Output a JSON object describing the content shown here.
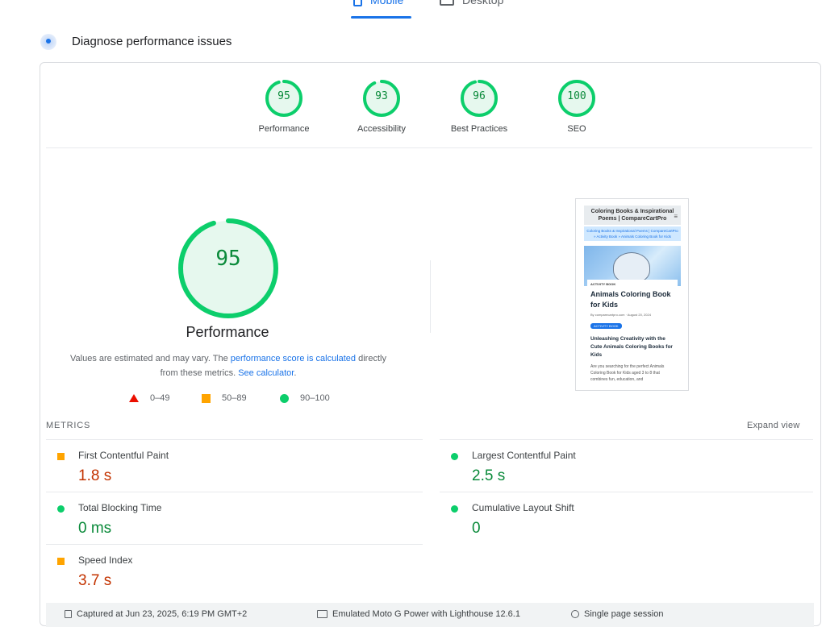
{
  "tabs": [
    {
      "label": "Mobile",
      "active": true,
      "icon": "phone-icon"
    },
    {
      "label": "Desktop",
      "active": false,
      "icon": "monitor-icon"
    }
  ],
  "header": {
    "title": "Diagnose performance issues"
  },
  "scores": [
    {
      "label": "Performance",
      "value": "95",
      "fraction": 0.95
    },
    {
      "label": "Accessibility",
      "value": "93",
      "fraction": 0.93
    },
    {
      "label": "Best Practices",
      "value": "96",
      "fraction": 0.96
    },
    {
      "label": "SEO",
      "value": "100",
      "fraction": 1.0
    }
  ],
  "main_score": {
    "value": "95",
    "fraction": 0.95,
    "title": "Performance",
    "note_prefix": "Values are estimated and may vary. The ",
    "note_link1": "performance score is calculated",
    "note_middle": " directly from these metrics. ",
    "note_link2": "See calculator",
    "note_suffix": "."
  },
  "legend": [
    {
      "range": "0–49",
      "shape": "triangle",
      "color": "#eb0f00"
    },
    {
      "range": "50–89",
      "shape": "square",
      "color": "#ffa400"
    },
    {
      "range": "90–100",
      "shape": "circle",
      "color": "#0cce6b"
    }
  ],
  "thumbnail": {
    "site_title": "Coloring Books & Inspirational Poems | CompareCartPro",
    "breadcrumb": "Coloring Books & Inspirational Poems | CompareCartPro » Activity Book » Animals Coloring Book for Kids",
    "category": "ACTIVITY BOOK",
    "post_title": "Animals Coloring Book for Kids",
    "meta": "By comparecartpro.com · August 20, 2024",
    "button": "ACTIVITY BOOK",
    "subtitle": "Unleashing Creativity with the Cute Animals Coloring Books for Kids",
    "body": "Are you searching for the perfect Animals Coloring Book for Kids aged 3 to 8 that combines fun, education, and"
  },
  "metrics": {
    "section_label": "METRICS",
    "expand_label": "Expand view",
    "items": [
      {
        "name": "First Contentful Paint",
        "value": "1.8 s",
        "rating": "average"
      },
      {
        "name": "Largest Contentful Paint",
        "value": "2.5 s",
        "rating": "good"
      },
      {
        "name": "Total Blocking Time",
        "value": "0 ms",
        "rating": "good"
      },
      {
        "name": "Cumulative Layout Shift",
        "value": "0",
        "rating": "good"
      },
      {
        "name": "Speed Index",
        "value": "3.7 s",
        "rating": "average"
      }
    ]
  },
  "footer": {
    "captured": "Captured at Jun 23, 2025, 6:19 PM GMT+2",
    "device": "Emulated Moto G Power with Lighthouse 12.6.1",
    "session": "Single page session"
  },
  "colors": {
    "accent": "#1a73e8",
    "good": "#0cce6b",
    "good_text": "#0a8a3a",
    "average": "#ffa400",
    "average_text": "#c33300",
    "poor": "#eb0f00"
  }
}
